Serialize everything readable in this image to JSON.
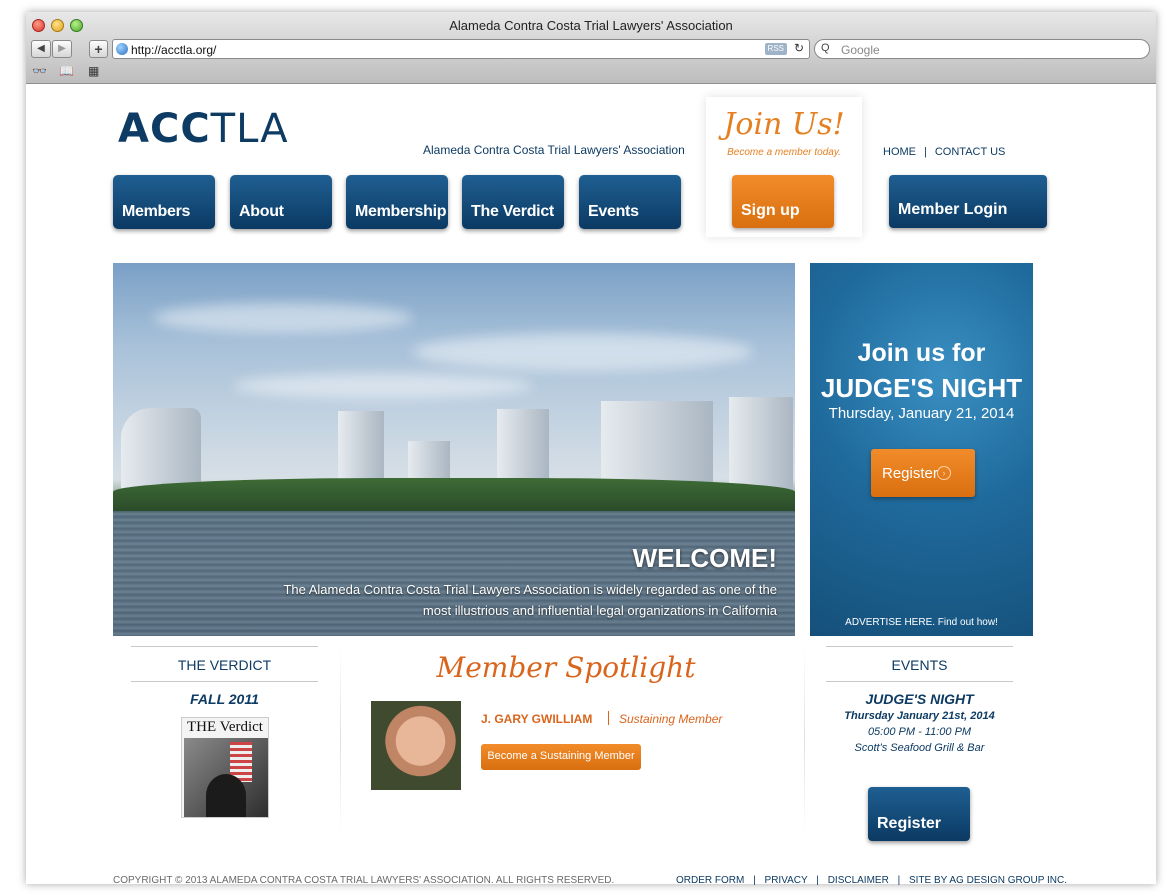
{
  "browser": {
    "window_title": "Alameda Contra Costa Trial Lawyers' Association",
    "back_icon": "◀",
    "forward_icon": "▶",
    "add_icon": "+",
    "url": "http://acctla.org/",
    "rss_label": "RSS",
    "reload_icon": "↻",
    "search_icon": "Q",
    "search_placeholder": "Google",
    "bookmark_icons": [
      "reading-glasses-icon",
      "book-icon",
      "grid-icon"
    ],
    "bookmark_glyphs": [
      "👓",
      "📖",
      "▦"
    ]
  },
  "site": {
    "logo_left": "ACC",
    "logo_right": "TLA",
    "tagline": "Alameda Contra Costa Trial Lawyers' Association",
    "brand_color": "#0d3b63",
    "accent_color": "#e58022",
    "nav": [
      {
        "label": "Members"
      },
      {
        "label": "About"
      },
      {
        "label": "Membership"
      },
      {
        "label": "The Verdict"
      },
      {
        "label": "Events"
      }
    ],
    "join": {
      "title": "Join Us!",
      "subtitle": "Become a member today.",
      "button": "Sign up"
    },
    "top_links": {
      "home": "HOME",
      "separator": "|",
      "contact": "CONTACT US"
    },
    "login_button": "Member Login"
  },
  "hero": {
    "title": "WELCOME!",
    "text": "The Alameda Contra Costa Trial Lawyers Association is widely regarded as one of the most illustrious and influential legal organizations in California"
  },
  "judges_night": {
    "line1": "Join us for",
    "line2": "JUDGE'S NIGHT",
    "date": "Thursday,  January 21, 2014",
    "button": "Register",
    "button_icon": "›",
    "advertise": "ADVERTISE HERE. Find out how!"
  },
  "verdict": {
    "heading": "THE VERDICT",
    "season": "FALL 2011",
    "cover_title": "THE Verdict"
  },
  "spotlight": {
    "title": "Member Spotlight",
    "name": "J. GARY GWILLIAM",
    "level": "Sustaining Member",
    "button": "Become a Sustaining Member"
  },
  "events": {
    "heading": "EVENTS",
    "title": "JUDGE'S NIGHT",
    "date": "Thursday January 21st, 2014",
    "time": "05:00 PM - 11:00 PM",
    "venue": "Scott's Seafood Grill & Bar",
    "button": "Register"
  },
  "footer": {
    "copyright": "COPYRIGHT © 2013 ALAMEDA CONTRA COSTA TRIAL LAWYERS' ASSOCIATION. ALL RIGHTS RESERVED.",
    "links": [
      "ORDER FORM",
      "PRIVACY",
      "DISCLAIMER",
      "SITE BY AG DESIGN GROUP INC."
    ],
    "separator": "|"
  }
}
